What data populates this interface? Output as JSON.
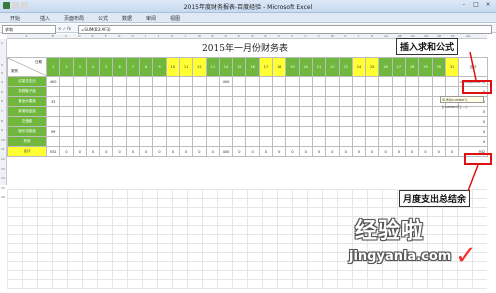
{
  "window": {
    "title": "2015年度财务报表-百度经验 - Microsoft Excel",
    "controls": [
      "-",
      "□",
      "×"
    ]
  },
  "ribbon": {
    "tabs": [
      "开始",
      "插入",
      "页面布局",
      "公式",
      "数据",
      "审阅",
      "视图"
    ]
  },
  "formula_bar": {
    "name_box": "求和",
    "fx": "× ✓ fx",
    "formula": "=SUM(B3:AF3)"
  },
  "sheet": {
    "title": "2015年一月份财务表",
    "corner_top": "日期",
    "corner_bottom": "类别",
    "total_header": "合计",
    "days": [
      "1",
      "2",
      "3",
      "4",
      "5",
      "6",
      "7",
      "8",
      "9",
      "10",
      "11",
      "12",
      "13",
      "14",
      "15",
      "16",
      "17",
      "18",
      "19",
      "20",
      "21",
      "22",
      "23",
      "24",
      "25",
      "26",
      "27",
      "28",
      "29",
      "30",
      "31"
    ],
    "highlight_days": [
      "10",
      "11",
      "12",
      "17",
      "18",
      "24",
      "25",
      "31"
    ],
    "rows": [
      {
        "label": "买菜总支出",
        "values": {
          "1": "400",
          "14": "400"
        },
        "total": "=SUM(B3:AF3)"
      },
      {
        "label": "衣物鞋子费",
        "values": {},
        "total": "0"
      },
      {
        "label": "食品水果费",
        "values": {
          "1": "33"
        },
        "total": "0"
      },
      {
        "label": "家用用品费",
        "values": {},
        "total": "0"
      },
      {
        "label": "交通费",
        "values": {},
        "total": "0"
      },
      {
        "label": "娱乐消费费",
        "values": {
          "1": "99"
        },
        "total": "0"
      },
      {
        "label": "其他",
        "values": {},
        "total": "0"
      }
    ],
    "sum_row": {
      "label": "合计",
      "values": [
        "532",
        "0",
        "0",
        "0",
        "0",
        "0",
        "0",
        "0",
        "0",
        "0",
        "0",
        "0",
        "0",
        "400",
        "0",
        "0",
        "0",
        "0",
        "0",
        "0",
        "0",
        "0",
        "0",
        "0",
        "0",
        "0",
        "0",
        "0",
        "0",
        "0",
        "0"
      ],
      "total": "932"
    },
    "tooltip": "SUM(number1, [number2], ...)"
  },
  "annotations": {
    "insert_sum": "插入求和公式",
    "monthly_total": "月度支出总结余"
  },
  "watermark": {
    "brand": "经验啦",
    "url": "jingyanla.com"
  }
}
